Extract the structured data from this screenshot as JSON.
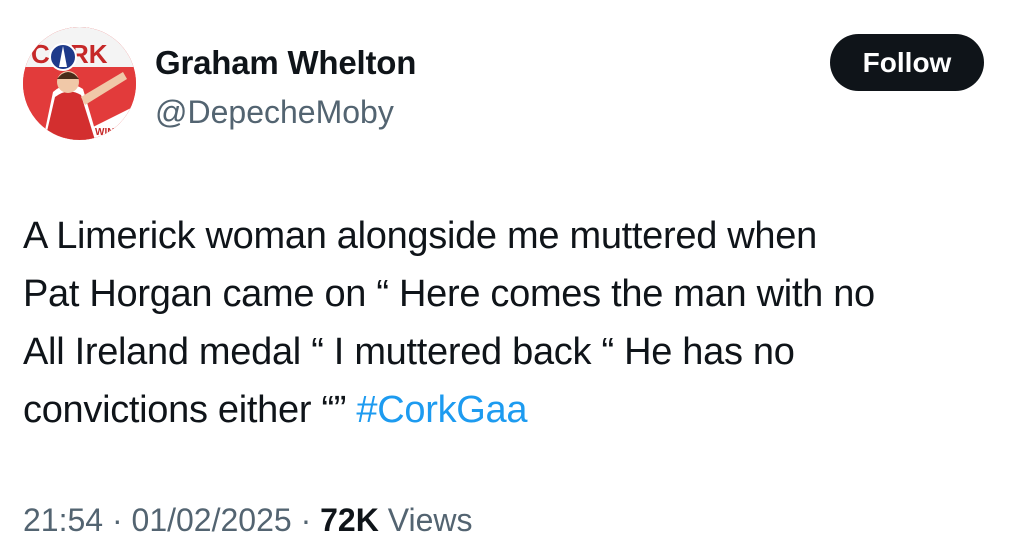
{
  "author": {
    "name": "Graham Whelton",
    "handle": "@DepecheMoby",
    "avatar_text": "CORK",
    "avatar_subtext": "WIN"
  },
  "follow_button": {
    "label": "Follow"
  },
  "tweet": {
    "lines": [
      "A Limerick woman alongside me muttered when",
      "Pat Horgan came on “ Here comes the man with no",
      "All Ireland medal “  I muttered back “ He has no",
      "convictions either “” "
    ],
    "hashtag": "#CorkGaa"
  },
  "meta": {
    "time": "21:54",
    "date": "01/02/2025",
    "separator": "·",
    "views_count": "72K",
    "views_label": "Views"
  },
  "colors": {
    "text": "#0f1419",
    "secondary": "#536471",
    "link": "#1d9bf0",
    "button_bg": "#0f1419",
    "avatar_red": "#e23b3b"
  }
}
